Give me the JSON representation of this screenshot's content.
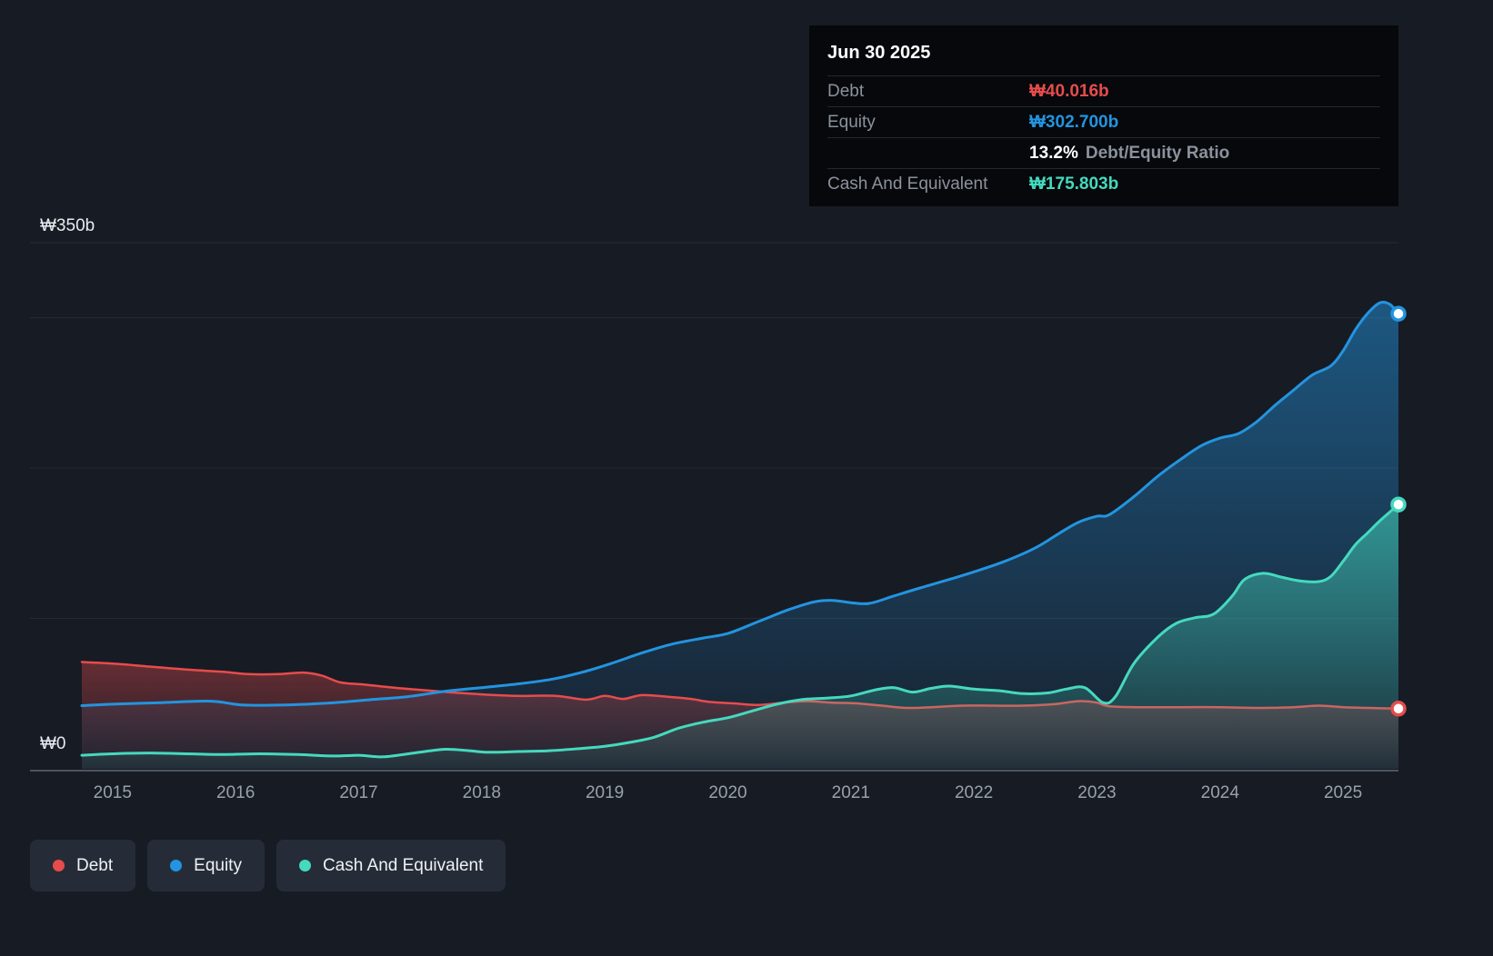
{
  "tooltip": {
    "date": "Jun 30 2025",
    "debt_label": "Debt",
    "debt_value": "₩40.016b",
    "equity_label": "Equity",
    "equity_value": "₩302.700b",
    "ratio_value": "13.2%",
    "ratio_label": "Debt/Equity Ratio",
    "cash_label": "Cash And Equivalent",
    "cash_value": "₩175.803b"
  },
  "axis": {
    "y_top_label": "₩350b",
    "y_zero_label": "₩0"
  },
  "legend": {
    "items": [
      {
        "label": "Debt",
        "color": "#e64c4c"
      },
      {
        "label": "Equity",
        "color": "#2394df"
      },
      {
        "label": "Cash And Equivalent",
        "color": "#45d9be"
      }
    ]
  },
  "chart_data": {
    "type": "area",
    "y_unit": "₩ billions",
    "ylim": [
      0,
      350
    ],
    "xlim": [
      2014.75,
      2025.45
    ],
    "gridlines": [
      0,
      100,
      200,
      300,
      350
    ],
    "grid": true,
    "legend_position": "bottom-left",
    "x_ticks": [
      {
        "x": 2015,
        "label": "2015"
      },
      {
        "x": 2016,
        "label": "2016"
      },
      {
        "x": 2017,
        "label": "2017"
      },
      {
        "x": 2018,
        "label": "2018"
      },
      {
        "x": 2019,
        "label": "2019"
      },
      {
        "x": 2020,
        "label": "2020"
      },
      {
        "x": 2021,
        "label": "2021"
      },
      {
        "x": 2022,
        "label": "2022"
      },
      {
        "x": 2023,
        "label": "2023"
      },
      {
        "x": 2024,
        "label": "2024"
      },
      {
        "x": 2025,
        "label": "2025"
      }
    ],
    "latest": {
      "date": "Jun 30 2025",
      "debt": 40.016,
      "equity": 302.7,
      "debt_equity_ratio_pct": 13.2,
      "cash_and_equivalent": 175.803
    },
    "series": [
      {
        "name": "Debt",
        "color": "#e64c4c",
        "points": [
          [
            2014.75,
            71
          ],
          [
            2015,
            70
          ],
          [
            2015.3,
            68
          ],
          [
            2015.6,
            66
          ],
          [
            2015.9,
            64.5
          ],
          [
            2016.1,
            63
          ],
          [
            2016.35,
            63
          ],
          [
            2016.55,
            64
          ],
          [
            2016.7,
            62
          ],
          [
            2016.85,
            57.5
          ],
          [
            2017.05,
            56
          ],
          [
            2017.35,
            53.5
          ],
          [
            2017.65,
            51.5
          ],
          [
            2018,
            49.5
          ],
          [
            2018.3,
            48.5
          ],
          [
            2018.6,
            48.5
          ],
          [
            2018.85,
            46
          ],
          [
            2019,
            48.5
          ],
          [
            2019.15,
            46.5
          ],
          [
            2019.3,
            49
          ],
          [
            2019.5,
            48
          ],
          [
            2019.7,
            46.5
          ],
          [
            2019.85,
            44.5
          ],
          [
            2020.05,
            43.5
          ],
          [
            2020.25,
            42.5
          ],
          [
            2020.45,
            44
          ],
          [
            2020.65,
            45
          ],
          [
            2020.85,
            44
          ],
          [
            2021.05,
            43.5
          ],
          [
            2021.25,
            42
          ],
          [
            2021.45,
            40.5
          ],
          [
            2021.65,
            41
          ],
          [
            2021.9,
            42
          ],
          [
            2022.15,
            42
          ],
          [
            2022.4,
            42
          ],
          [
            2022.65,
            43
          ],
          [
            2022.85,
            45
          ],
          [
            2023,
            44
          ],
          [
            2023.1,
            41.5
          ],
          [
            2023.35,
            41
          ],
          [
            2023.7,
            41
          ],
          [
            2024,
            41
          ],
          [
            2024.3,
            40.5
          ],
          [
            2024.6,
            41
          ],
          [
            2024.8,
            42
          ],
          [
            2025,
            41
          ],
          [
            2025.2,
            40.5
          ],
          [
            2025.45,
            40.016
          ]
        ]
      },
      {
        "name": "Equity",
        "color": "#2394df",
        "points": [
          [
            2014.75,
            42
          ],
          [
            2015,
            43
          ],
          [
            2015.4,
            44
          ],
          [
            2015.8,
            45
          ],
          [
            2016.05,
            42.5
          ],
          [
            2016.4,
            42.5
          ],
          [
            2016.8,
            44
          ],
          [
            2017.1,
            46
          ],
          [
            2017.4,
            48
          ],
          [
            2017.7,
            51.5
          ],
          [
            2018,
            54
          ],
          [
            2018.3,
            56.5
          ],
          [
            2018.6,
            60
          ],
          [
            2018.85,
            65
          ],
          [
            2019.05,
            70
          ],
          [
            2019.3,
            77
          ],
          [
            2019.55,
            83
          ],
          [
            2019.8,
            87
          ],
          [
            2020,
            90
          ],
          [
            2020.25,
            98
          ],
          [
            2020.5,
            106
          ],
          [
            2020.7,
            111
          ],
          [
            2020.85,
            112
          ],
          [
            2021,
            110.5
          ],
          [
            2021.15,
            110
          ],
          [
            2021.35,
            115
          ],
          [
            2021.55,
            120
          ],
          [
            2021.8,
            126
          ],
          [
            2022,
            131
          ],
          [
            2022.25,
            138
          ],
          [
            2022.5,
            147
          ],
          [
            2022.7,
            157
          ],
          [
            2022.85,
            164
          ],
          [
            2023,
            168
          ],
          [
            2023.1,
            169
          ],
          [
            2023.3,
            181
          ],
          [
            2023.5,
            195
          ],
          [
            2023.7,
            207
          ],
          [
            2023.85,
            215
          ],
          [
            2024,
            220
          ],
          [
            2024.15,
            223
          ],
          [
            2024.3,
            231
          ],
          [
            2024.45,
            242
          ],
          [
            2024.6,
            252
          ],
          [
            2024.75,
            262
          ],
          [
            2024.9,
            268
          ],
          [
            2025,
            278
          ],
          [
            2025.1,
            292
          ],
          [
            2025.2,
            303
          ],
          [
            2025.3,
            310
          ],
          [
            2025.38,
            309
          ],
          [
            2025.45,
            302.7
          ]
        ]
      },
      {
        "name": "Cash And Equivalent",
        "color": "#45d9be",
        "points": [
          [
            2014.75,
            9
          ],
          [
            2015,
            10
          ],
          [
            2015.3,
            10.5
          ],
          [
            2015.6,
            10
          ],
          [
            2015.9,
            9.5
          ],
          [
            2016.2,
            10
          ],
          [
            2016.5,
            9.5
          ],
          [
            2016.8,
            8.5
          ],
          [
            2017,
            9
          ],
          [
            2017.2,
            8
          ],
          [
            2017.45,
            10.5
          ],
          [
            2017.7,
            13
          ],
          [
            2017.9,
            12
          ],
          [
            2018.05,
            11
          ],
          [
            2018.3,
            11.5
          ],
          [
            2018.55,
            12
          ],
          [
            2018.8,
            13.5
          ],
          [
            2019,
            15
          ],
          [
            2019.2,
            17.5
          ],
          [
            2019.4,
            21
          ],
          [
            2019.6,
            27
          ],
          [
            2019.8,
            31
          ],
          [
            2020,
            34
          ],
          [
            2020.2,
            38.5
          ],
          [
            2020.4,
            43
          ],
          [
            2020.6,
            46
          ],
          [
            2020.8,
            47
          ],
          [
            2021,
            48.5
          ],
          [
            2021.2,
            52.5
          ],
          [
            2021.35,
            54
          ],
          [
            2021.5,
            51
          ],
          [
            2021.65,
            53.5
          ],
          [
            2021.8,
            55
          ],
          [
            2022,
            53
          ],
          [
            2022.2,
            52
          ],
          [
            2022.4,
            50
          ],
          [
            2022.6,
            50.5
          ],
          [
            2022.75,
            53
          ],
          [
            2022.9,
            54
          ],
          [
            2023.05,
            44
          ],
          [
            2023.15,
            48
          ],
          [
            2023.3,
            70
          ],
          [
            2023.5,
            88
          ],
          [
            2023.65,
            97
          ],
          [
            2023.8,
            100.5
          ],
          [
            2023.95,
            103
          ],
          [
            2024.1,
            115
          ],
          [
            2024.2,
            126
          ],
          [
            2024.35,
            130
          ],
          [
            2024.5,
            127.5
          ],
          [
            2024.65,
            125
          ],
          [
            2024.8,
            124.5
          ],
          [
            2024.9,
            128
          ],
          [
            2025,
            138
          ],
          [
            2025.1,
            149
          ],
          [
            2025.2,
            157
          ],
          [
            2025.3,
            165
          ],
          [
            2025.45,
            175.803
          ]
        ]
      }
    ]
  }
}
